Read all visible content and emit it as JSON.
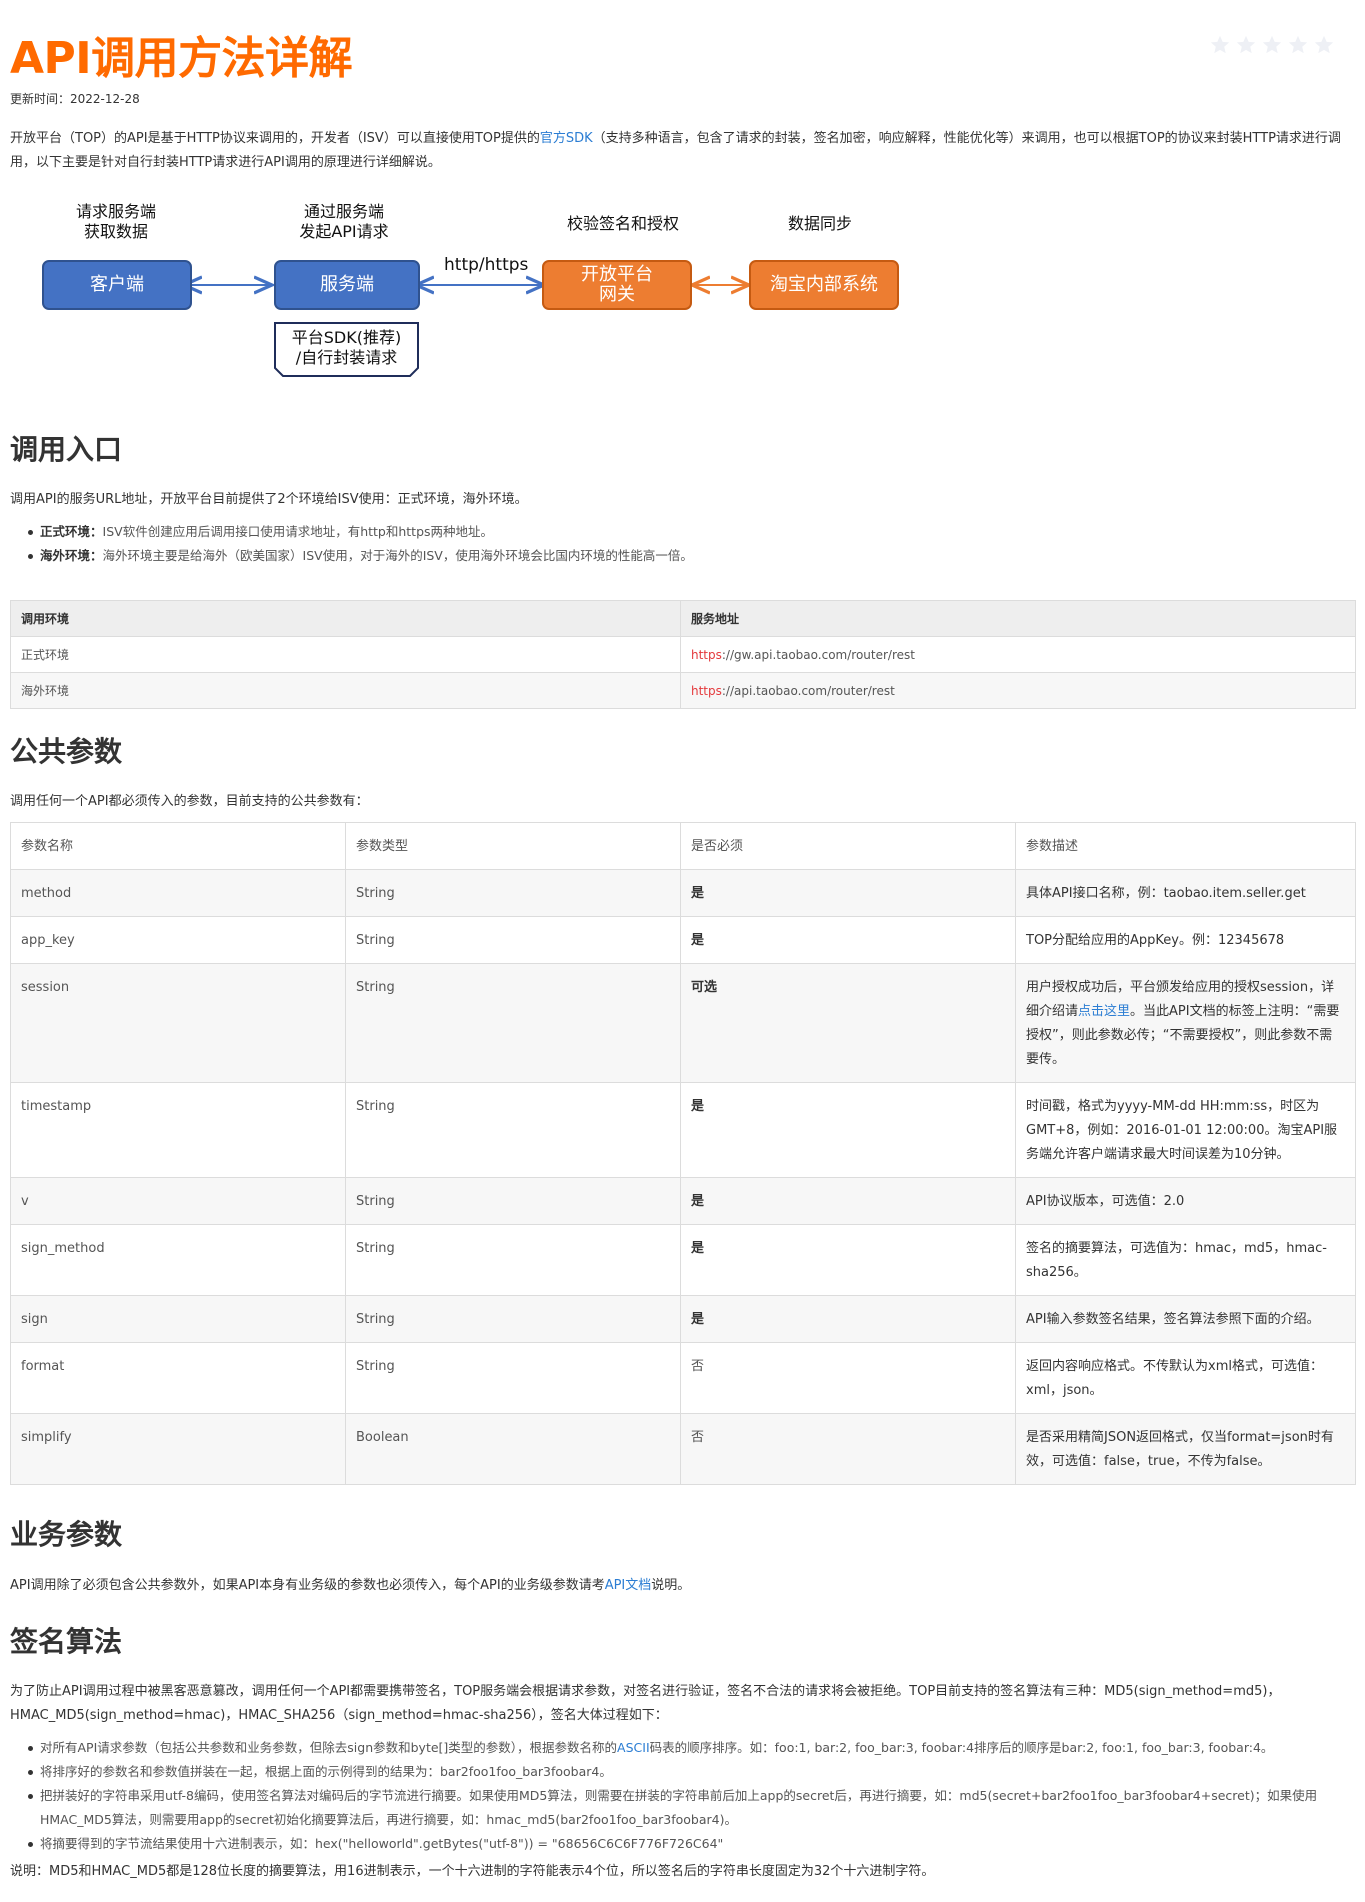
{
  "title": "API调用方法详解",
  "rating": {
    "stars": 5,
    "filled": 0
  },
  "updated": "更新时间：2022-12-28",
  "intro": {
    "before_link": "开放平台（TOP）的API是基于HTTP协议来调用的，开发者（ISV）可以直接使用TOP提供的",
    "link": "官方SDK",
    "after_link": "（支持多种语言，包含了请求的封装，签名加密，响应解释，性能优化等）来调用，也可以根据TOP的协议来封装HTTP请求进行调用，以下主要是针对自行封装HTTP请求进行API调用的原理进行详细解说。"
  },
  "diagram": {
    "labels": {
      "client": "请求服务端\n获取数据",
      "server": "通过服务端\n发起API请求",
      "gateway": "校验签名和授权",
      "internal": "数据同步"
    },
    "boxes": {
      "client": "客户端",
      "server": "服务端",
      "gateway": "开放平台\n网关",
      "internal": "淘宝内部系统"
    },
    "arrow_label": "http/https",
    "sdk": "平台SDK(推荐)\n/自行封装请求"
  },
  "sections": {
    "entry": {
      "heading": "调用入口",
      "desc": "调用API的服务URL地址，开放平台目前提供了2个环境给ISV使用：正式环境，海外环境。",
      "bullets": [
        {
          "label": "正式环境：",
          "text": "ISV软件创建应用后调用接口使用请求地址，有http和https两种地址。"
        },
        {
          "label": "海外环境：",
          "text": "海外环境主要是给海外（欧美国家）ISV使用，对于海外的ISV，使用海外环境会比国内环境的性能高一倍。"
        }
      ],
      "table": {
        "headers": [
          "调用环境",
          "服务地址"
        ],
        "rows": [
          {
            "env": "正式环境",
            "scheme": "https",
            "rest": "://gw.api.taobao.com/router/rest"
          },
          {
            "env": "海外环境",
            "scheme": "https",
            "rest": "://api.taobao.com/router/rest"
          }
        ]
      }
    },
    "public_params": {
      "heading": "公共参数",
      "desc": "调用任何一个API都必须传入的参数，目前支持的公共参数有：",
      "headers": [
        "参数名称",
        "参数类型",
        "是否必须",
        "参数描述"
      ],
      "rows": [
        {
          "name": "method",
          "type": "String",
          "required": "是",
          "desc": "具体API接口名称，例：taobao.item.seller.get"
        },
        {
          "name": "app_key",
          "type": "String",
          "required": "是",
          "desc": "TOP分配给应用的AppKey。例：12345678"
        },
        {
          "name": "session",
          "type": "String",
          "required": "可选",
          "desc_before": "用户授权成功后，平台颁发给应用的授权session，详细介绍请",
          "desc_link": "点击这里",
          "desc_after": "。当此API文档的标签上注明：“需要授权”，则此参数必传；“不需要授权”，则此参数不需要传。"
        },
        {
          "name": "timestamp",
          "type": "String",
          "required": "是",
          "desc": "时间戳，格式为yyyy-MM-dd HH:mm:ss，时区为GMT+8，例如：2016-01-01 12:00:00。淘宝API服务端允许客户端请求最大时间误差为10分钟。"
        },
        {
          "name": "v",
          "type": "String",
          "required": "是",
          "desc": "API协议版本，可选值：2.0"
        },
        {
          "name": "sign_method",
          "type": "String",
          "required": "是",
          "desc": "签名的摘要算法，可选值为：hmac，md5，hmac-sha256。"
        },
        {
          "name": "sign",
          "type": "String",
          "required": "是",
          "desc": "API输入参数签名结果，签名算法参照下面的介绍。"
        },
        {
          "name": "format",
          "type": "String",
          "required": "否",
          "desc": "返回内容响应格式。不传默认为xml格式，可选值：xml，json。"
        },
        {
          "name": "simplify",
          "type": "Boolean",
          "required": "否",
          "desc": "是否采用精简JSON返回格式，仅当format=json时有效，可选值：false，true，不传为false。"
        }
      ]
    },
    "biz_params": {
      "heading": "业务参数",
      "before_link": "API调用除了必须包含公共参数外，如果API本身有业务级的参数也必须传入，每个API的业务级参数请考",
      "link": "API文档",
      "after_link": "说明。"
    },
    "sign": {
      "heading": "签名算法",
      "desc": "为了防止API调用过程中被黑客恶意篡改，调用任何一个API都需要携带签名，TOP服务端会根据请求参数，对签名进行验证，签名不合法的请求将会被拒绝。TOP目前支持的签名算法有三种：MD5(sign_method=md5)，HMAC_MD5(sign_method=hmac)，HMAC_SHA256（sign_method=hmac-sha256），签名大体过程如下：",
      "bullets": [
        {
          "before": "对所有API请求参数（包括公共参数和业务参数，但除去sign参数和byte[]类型的参数），根据参数名称的",
          "link": "ASCII",
          "after": "码表的顺序排序。如：foo:1, bar:2, foo_bar:3, foobar:4排序后的顺序是bar:2, foo:1, foo_bar:3, foobar:4。"
        },
        {
          "text": "将排序好的参数名和参数值拼装在一起，根据上面的示例得到的结果为：bar2foo1foo_bar3foobar4。"
        },
        {
          "text": "把拼装好的字符串采用utf-8编码，使用签名算法对编码后的字节流进行摘要。如果使用MD5算法，则需要在拼装的字符串前后加上app的secret后，再进行摘要，如：md5(secret+bar2foo1foo_bar3foobar4+secret)；如果使用HMAC_MD5算法，则需要用app的secret初始化摘要算法后，再进行摘要，如：hmac_md5(bar2foo1foo_bar3foobar4)。"
        },
        {
          "text": "将摘要得到的字节流结果使用十六进制表示，如：hex(\"helloworld\".getBytes(\"utf-8\")) = \"68656C6C6F776F726C64\""
        }
      ],
      "note": "说明：MD5和HMAC_MD5都是128位长度的摘要算法，用16进制表示，一个十六进制的字符能表示4个位，所以签名后的字符串长度固定为32个十六进制字符。"
    }
  },
  "colors": {
    "title": "#ff6a00",
    "link": "#2b7dd3",
    "blue_box": "#4472c4",
    "orange_box": "#ed7d31",
    "https": "#e4393c"
  }
}
